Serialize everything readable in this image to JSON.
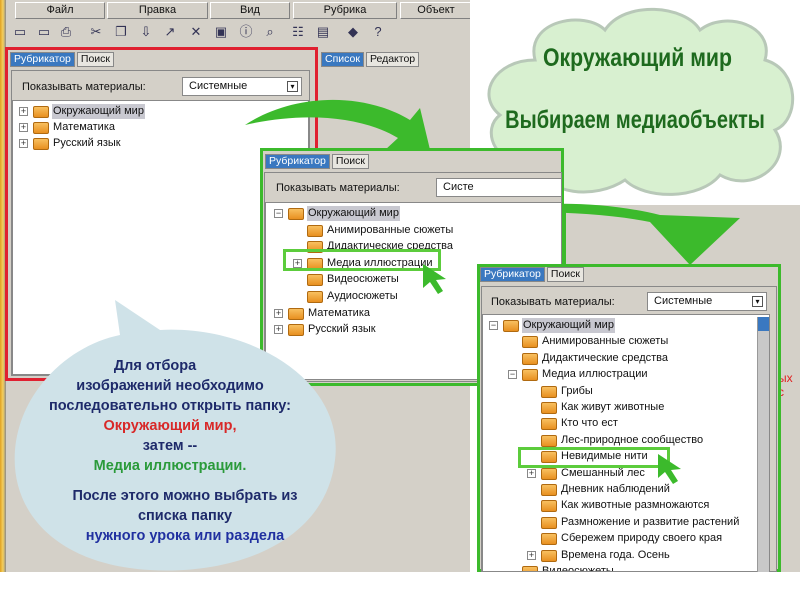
{
  "menu": [
    "Файл",
    "Правка",
    "Вид",
    "Рубрика",
    "Объект"
  ],
  "toolbar_icons": [
    "new-icon",
    "open-icon",
    "print-icon",
    "cut-icon",
    "copy-icon",
    "download-icon",
    "export-icon",
    "delete-icon",
    "save-icon",
    "info-icon",
    "search-icon",
    "tree-icon",
    "select-icon",
    "book-icon",
    "help-icon"
  ],
  "tabs": {
    "rubricator": "Рубрикатор",
    "search": "Поиск",
    "list": "Список",
    "editor": "Редактор"
  },
  "filter": {
    "label": "Показывать материалы:",
    "value": "Системные",
    "value_short": "Систе"
  },
  "tree1": [
    {
      "label": "Окружающий мир",
      "level": 0,
      "exp": "+",
      "sel": true
    },
    {
      "label": "Математика",
      "level": 0,
      "exp": "+"
    },
    {
      "label": "Русский язык",
      "level": 0,
      "exp": "+"
    }
  ],
  "tree2": [
    {
      "label": "Окружающий мир",
      "level": 0,
      "exp": "-",
      "sel": true
    },
    {
      "label": "Анимированные сюжеты",
      "level": 1,
      "exp": ""
    },
    {
      "label": "Дидактические средства",
      "level": 1,
      "exp": ""
    },
    {
      "label": "Медиа иллюстрации",
      "level": 1,
      "exp": "+"
    },
    {
      "label": "Видеосюжеты",
      "level": 1,
      "exp": ""
    },
    {
      "label": "Аудиосюжеты",
      "level": 1,
      "exp": ""
    },
    {
      "label": "Математика",
      "level": 0,
      "exp": "+"
    },
    {
      "label": "Русский язык",
      "level": 0,
      "exp": "+"
    }
  ],
  "tree3": [
    {
      "label": "Окружающий мир",
      "level": 0,
      "exp": "-",
      "sel": true
    },
    {
      "label": "Анимированные сюжеты",
      "level": 1,
      "exp": ""
    },
    {
      "label": "Дидактические средства",
      "level": 1,
      "exp": ""
    },
    {
      "label": "Медиа иллюстрации",
      "level": 1,
      "exp": "-"
    },
    {
      "label": "Грибы",
      "level": 2,
      "exp": ""
    },
    {
      "label": "Как живут животные",
      "level": 2,
      "exp": ""
    },
    {
      "label": "Кто что ест",
      "level": 2,
      "exp": ""
    },
    {
      "label": "Лес-природное сообщество",
      "level": 2,
      "exp": ""
    },
    {
      "label": "Невидимые нити",
      "level": 2,
      "exp": ""
    },
    {
      "label": "Смешанный лес",
      "level": 2,
      "exp": "+"
    },
    {
      "label": "Дневник наблюдений",
      "level": 2,
      "exp": ""
    },
    {
      "label": "Как животные размножаются",
      "level": 2,
      "exp": ""
    },
    {
      "label": "Размножение и развитие растений",
      "level": 2,
      "exp": ""
    },
    {
      "label": "Сбережем природу своего края",
      "level": 2,
      "exp": ""
    },
    {
      "label": "Времена года. Осень",
      "level": 2,
      "exp": "+"
    },
    {
      "label": "Видеосюжеты",
      "level": 1,
      "exp": ""
    }
  ],
  "cloud": {
    "title": "Окружающий мир",
    "subtitle": "Выбираем медиаобъекты"
  },
  "bubble": {
    "l1": "Для отбора",
    "l2": "изображений необходимо",
    "l3": "последовательно открыть папку:",
    "l4": "Окружающий мир,",
    "l5": "затем --",
    "l6": "Медиа иллюстрации.",
    "l7": "После этого можно выбрать из",
    "l8": "списка папку",
    "l9": "нужного урока или раздела"
  },
  "side_fragment": "ых с",
  "colors": {
    "green": "#3cba2c",
    "red": "#e02020",
    "bubble": "#cfe2e8",
    "cloud": "#d8f0d0"
  }
}
